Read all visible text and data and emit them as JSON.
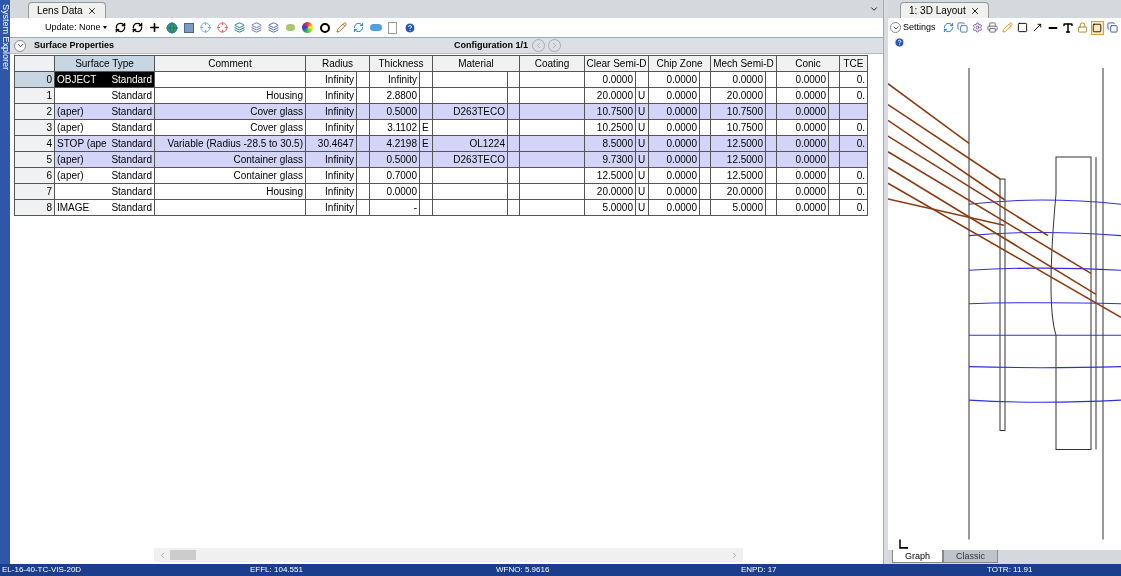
{
  "side_strip": {
    "title": "System Explorer"
  },
  "lens_data": {
    "tab": "Lens Data",
    "update_label": "Update: None",
    "section": "Surface Properties",
    "configuration": "Configuration 1/1",
    "columns": [
      "Surface Type",
      "Comment",
      "Radius",
      "Thickness",
      "Material",
      "Coating",
      "Clear Semi-D",
      "Chip Zone",
      "Mech Semi-D",
      "Conic",
      "TCE"
    ],
    "rows": [
      {
        "num": "0",
        "label": "OBJECT",
        "type": "Standard",
        "comment": "",
        "radius": "Infinity",
        "radius_solve": "",
        "thickness": "Infinity",
        "thickness_solve": "",
        "material": "",
        "coating": "",
        "clear": "0.0000",
        "clear_solve": "",
        "chip": "0.0000",
        "mech": "0.0000",
        "conic": "0.0000",
        "tce": "0.",
        "highlighted": false,
        "selected": true
      },
      {
        "num": "1",
        "label": "",
        "type": "Standard",
        "comment": "Housing",
        "radius": "Infinity",
        "radius_solve": "",
        "thickness": "2.8800",
        "thickness_solve": "",
        "material": "",
        "coating": "",
        "clear": "20.0000",
        "clear_solve": "U",
        "chip": "0.0000",
        "mech": "20.0000",
        "conic": "0.0000",
        "tce": "0.",
        "highlighted": false,
        "selected": false
      },
      {
        "num": "2",
        "label": "(aper)",
        "type": "Standard",
        "comment": "Cover glass",
        "radius": "Infinity",
        "radius_solve": "",
        "thickness": "0.5000",
        "thickness_solve": "",
        "material": "D263TECO",
        "coating": "",
        "clear": "10.7500",
        "clear_solve": "U",
        "chip": "0.0000",
        "mech": "10.7500",
        "conic": "0.0000",
        "tce": "",
        "highlighted": true,
        "selected": false
      },
      {
        "num": "3",
        "label": "(aper)",
        "type": "Standard",
        "comment": "Cover glass",
        "radius": "Infinity",
        "radius_solve": "",
        "thickness": "3.1102",
        "thickness_solve": "E",
        "material": "",
        "coating": "",
        "clear": "10.2500",
        "clear_solve": "U",
        "chip": "0.0000",
        "mech": "10.7500",
        "conic": "0.0000",
        "tce": "0.",
        "highlighted": false,
        "selected": false
      },
      {
        "num": "4",
        "label": "STOP (ape",
        "type": "Standard",
        "comment": "Variable (Radius -28.5 to 30.5)",
        "radius": "30.4647",
        "radius_solve": "",
        "thickness": "4.2198",
        "thickness_solve": "E",
        "material": "OL1224",
        "coating": "",
        "clear": "8.5000",
        "clear_solve": "U",
        "chip": "0.0000",
        "mech": "12.5000",
        "conic": "0.0000",
        "tce": "0.",
        "highlighted": true,
        "selected": false
      },
      {
        "num": "5",
        "label": "(aper)",
        "type": "Standard",
        "comment": "Container glass",
        "radius": "Infinity",
        "radius_solve": "",
        "thickness": "0.5000",
        "thickness_solve": "",
        "material": "D263TECO",
        "coating": "",
        "clear": "9.7300",
        "clear_solve": "U",
        "chip": "0.0000",
        "mech": "12.5000",
        "conic": "0.0000",
        "tce": "",
        "highlighted": true,
        "selected": false
      },
      {
        "num": "6",
        "label": "(aper)",
        "type": "Standard",
        "comment": "Container glass",
        "radius": "Infinity",
        "radius_solve": "",
        "thickness": "0.7000",
        "thickness_solve": "",
        "material": "",
        "coating": "",
        "clear": "12.5000",
        "clear_solve": "U",
        "chip": "0.0000",
        "mech": "12.5000",
        "conic": "0.0000",
        "tce": "0.",
        "highlighted": false,
        "selected": false
      },
      {
        "num": "7",
        "label": "",
        "type": "Standard",
        "comment": "Housing",
        "radius": "Infinity",
        "radius_solve": "",
        "thickness": "0.0000",
        "thickness_solve": "",
        "material": "",
        "coating": "",
        "clear": "20.0000",
        "clear_solve": "U",
        "chip": "0.0000",
        "mech": "20.0000",
        "conic": "0.0000",
        "tce": "0.",
        "highlighted": false,
        "selected": false
      },
      {
        "num": "8",
        "label": "IMAGE",
        "type": "Standard",
        "comment": "",
        "radius": "Infinity",
        "radius_solve": "",
        "thickness": "-",
        "thickness_solve": "",
        "material": "",
        "coating": "",
        "clear": "5.0000",
        "clear_solve": "U",
        "chip": "0.0000",
        "mech": "5.0000",
        "conic": "0.0000",
        "tce": "0.",
        "highlighted": false,
        "selected": false
      }
    ]
  },
  "layout_3d": {
    "tab": "1: 3D Layout",
    "settings": "Settings",
    "bottom_tabs": [
      {
        "label": "Graph",
        "selected": true
      },
      {
        "label": "Classic",
        "selected": false
      }
    ]
  },
  "status_bar": [
    "EL-16-40-TC-VIS-20D",
    "EFFL: 104.551",
    "WFNO: 5.9616",
    "ENPD: 17",
    "TOTR: 11.91"
  ]
}
